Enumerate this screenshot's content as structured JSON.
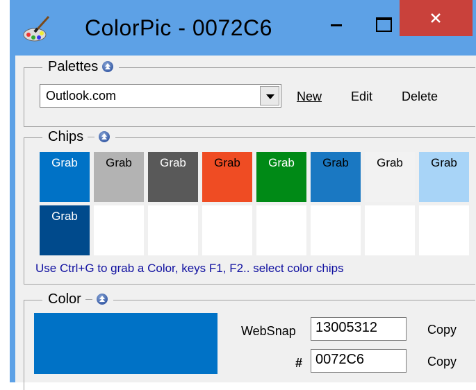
{
  "window": {
    "title": "ColorPic - 0072C6"
  },
  "icons": {
    "app": "color-palette-brush-icon",
    "minimize": "minimize-icon",
    "maximize": "maximize-icon",
    "close": "close-icon",
    "collapse": "collapse-up-icon"
  },
  "palettes": {
    "label": "Palettes",
    "selected": "Outlook.com",
    "new_label": "New",
    "edit_label": "Edit",
    "delete_label": "Delete"
  },
  "chips": {
    "label": "Chips",
    "grab_label": "Grab",
    "colors": [
      "#0072c6",
      "#b3b3b3",
      "#595959",
      "#ef4c23",
      "#008a16",
      "#1a78c2",
      "#f2f2f2",
      "#a8d4f7",
      "#004a8c"
    ],
    "hint": "Use Ctrl+G to grab a Color, keys F1, F2.. select color chips"
  },
  "color": {
    "label": "Color",
    "current": "#0072c6",
    "websnap_label": "WebSnap",
    "websnap_value": "13005312",
    "hex_label": "#",
    "hex_value": "0072C6",
    "copy_label": "Copy"
  }
}
